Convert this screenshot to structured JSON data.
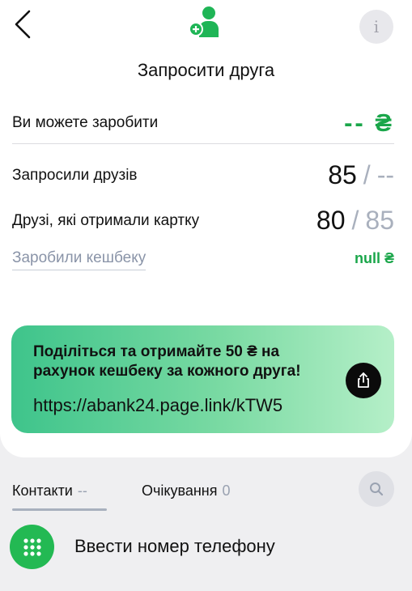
{
  "header": {
    "back_icon": "chevron-left-icon",
    "logo_icon": "add-user-icon",
    "info_label": "i",
    "title": "Запросити друга"
  },
  "earn": {
    "label": "Ви можете заробити",
    "value": "-- ₴"
  },
  "invited": {
    "label": "Запросили друзів",
    "value": "85",
    "separator": "/",
    "total": "--"
  },
  "got_card": {
    "label": "Друзі, які отримали картку",
    "value": "80",
    "separator": "/",
    "total": "85"
  },
  "cashback": {
    "label": "Заробили кешбеку",
    "value": "null ₴"
  },
  "promo": {
    "text": "Поділіться та отримайте 50 ₴ на рахунок кешбеку за кожного друга!",
    "link": "https://abank24.page.link/kTW5",
    "share_icon": "share-icon"
  },
  "tabs": [
    {
      "label": "Контакти",
      "count": "--"
    },
    {
      "label": "Очікування",
      "count": "0"
    }
  ],
  "search_icon": "search-icon",
  "dial": {
    "icon": "dialpad-icon",
    "label": "Ввести номер телефону"
  },
  "colors": {
    "accent_green": "#1aa64a",
    "dial_green": "#23b953",
    "muted": "#a9b0bd"
  }
}
